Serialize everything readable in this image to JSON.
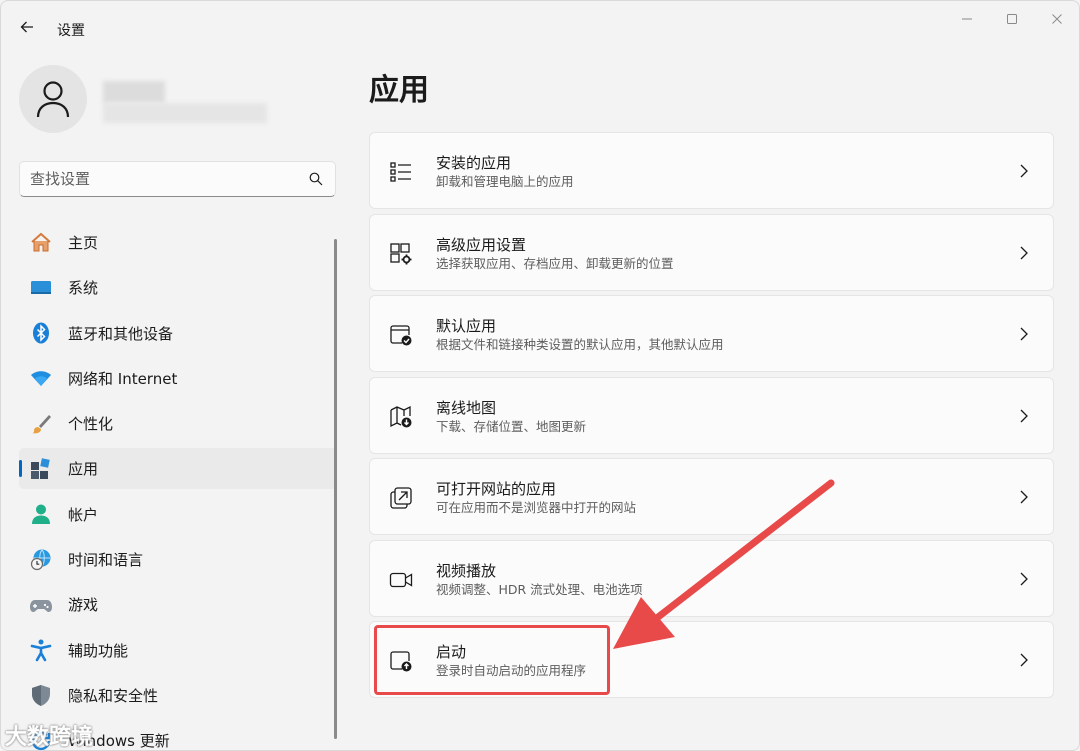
{
  "window": {
    "title": "设置"
  },
  "profile": {},
  "search": {
    "placeholder": "查找设置"
  },
  "sidebar": {
    "items": [
      {
        "label": "主页",
        "icon": "home-icon"
      },
      {
        "label": "系统",
        "icon": "system-icon"
      },
      {
        "label": "蓝牙和其他设备",
        "icon": "bluetooth-icon"
      },
      {
        "label": "网络和 Internet",
        "icon": "wifi-icon"
      },
      {
        "label": "个性化",
        "icon": "brush-icon"
      },
      {
        "label": "应用",
        "icon": "apps-icon",
        "active": true
      },
      {
        "label": "帐户",
        "icon": "account-icon"
      },
      {
        "label": "时间和语言",
        "icon": "time-language-icon"
      },
      {
        "label": "游戏",
        "icon": "gamepad-icon"
      },
      {
        "label": "辅助功能",
        "icon": "accessibility-icon"
      },
      {
        "label": "隐私和安全性",
        "icon": "shield-icon"
      },
      {
        "label": "Windows 更新",
        "icon": "update-icon"
      }
    ]
  },
  "main": {
    "title": "应用",
    "cards": [
      {
        "title": "安装的应用",
        "subtitle": "卸载和管理电脑上的应用",
        "icon": "list-icon"
      },
      {
        "title": "高级应用设置",
        "subtitle": "选择获取应用、存档应用、卸载更新的位置",
        "icon": "app-settings-icon"
      },
      {
        "title": "默认应用",
        "subtitle": "根据文件和链接种类设置的默认应用，其他默认应用",
        "icon": "default-apps-icon"
      },
      {
        "title": "离线地图",
        "subtitle": "下载、存储位置、地图更新",
        "icon": "map-download-icon"
      },
      {
        "title": "可打开网站的应用",
        "subtitle": "可在应用而不是浏览器中打开的网站",
        "icon": "open-external-icon"
      },
      {
        "title": "视频播放",
        "subtitle": "视频调整、HDR 流式处理、电池选项",
        "icon": "video-icon"
      },
      {
        "title": "启动",
        "subtitle": "登录时自动启动的应用程序",
        "icon": "startup-icon"
      }
    ]
  },
  "annotation": {
    "highlight_color": "#e84a4a",
    "watermark": "大数跨境"
  },
  "colors": {
    "accent": "#0067c0",
    "window_bg": "#f3f3f3",
    "card_bg": "#fbfbfb"
  }
}
